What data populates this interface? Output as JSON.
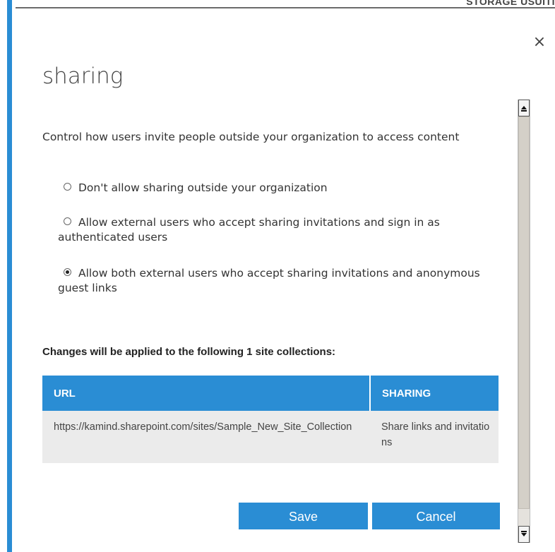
{
  "background_header": {
    "text": "STORAGE USUITI"
  },
  "dialog": {
    "close_glyph": "×",
    "title": "sharing",
    "description": "Control how users invite people outside your organization to access content",
    "options": [
      {
        "label": "Don't allow sharing outside your organization",
        "checked": false
      },
      {
        "label": "Allow external users who accept sharing invitations and sign in as authenticated users",
        "checked": false
      },
      {
        "label": "Allow both external users who accept sharing invitations and anonymous guest links",
        "checked": true
      }
    ],
    "changes_text": "Changes will be applied to the following 1 site collections:",
    "table": {
      "headers": [
        "URL",
        "SHARING"
      ],
      "rows": [
        [
          "https://kamind.sharepoint.com/sites/Sample_New_Site_Collection",
          "Share links and invitations"
        ]
      ]
    },
    "buttons": {
      "save": "Save",
      "cancel": "Cancel"
    }
  },
  "colors": {
    "accent": "#2a8dd4",
    "row_bg": "#ebebeb",
    "scrollbar": "#d4d0c8"
  },
  "icons": [
    "close-icon",
    "scroll-up-icon",
    "scroll-down-icon",
    "radio-button"
  ]
}
